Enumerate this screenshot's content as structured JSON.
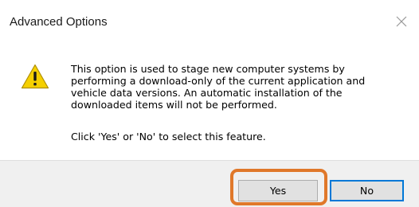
{
  "window": {
    "title": "Advanced Options",
    "close_icon": "close-icon"
  },
  "content": {
    "icon": "warning-icon",
    "message_lines": [
      "This option is used to stage new computer systems by",
      "performing a download-only of the current application and",
      "vehicle data versions.  An automatic installation of the",
      "downloaded items will not be performed."
    ],
    "prompt": "Click 'Yes' or 'No' to select this feature."
  },
  "buttons": {
    "yes_label": "Yes",
    "no_label": "No",
    "default_button": "No"
  },
  "colors": {
    "highlight": "#e0782a",
    "focus_border": "#0078d7",
    "warning_fill": "#f5d000",
    "footer_background": "#f0f0f0"
  }
}
